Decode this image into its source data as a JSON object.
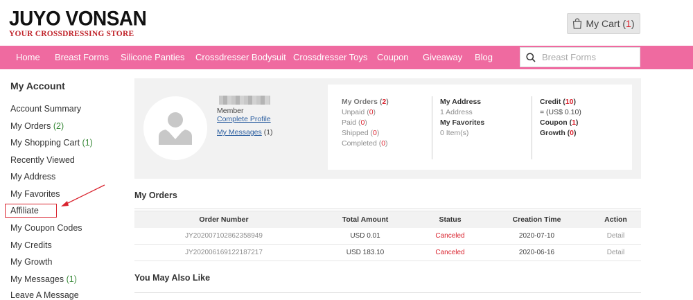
{
  "brand": {
    "name": "JUYO VONSAN",
    "tagline": "YOUR CROSSDRESSING STORE"
  },
  "cart": {
    "label": "My Cart",
    "count_open": "(",
    "count": "1",
    "count_close": ")"
  },
  "nav": [
    {
      "label": "Home"
    },
    {
      "label": "Breast Forms"
    },
    {
      "label": "Silicone Panties"
    },
    {
      "label": "Crossdresser Bodysuit"
    },
    {
      "label": "Crossdresser Toys"
    },
    {
      "label": "Coupon"
    },
    {
      "label": "Giveaway"
    },
    {
      "label": "Blog"
    }
  ],
  "search": {
    "placeholder": "Breast Forms"
  },
  "sidebar": {
    "title": "My Account",
    "items": [
      {
        "label": "Account Summary",
        "count": ""
      },
      {
        "label": "My Orders",
        "count": "(2)"
      },
      {
        "label": "My Shopping Cart",
        "count": "(1)"
      },
      {
        "label": "Recently Viewed",
        "count": ""
      },
      {
        "label": "My Address",
        "count": ""
      },
      {
        "label": "My Favorites",
        "count": ""
      },
      {
        "label": "Affiliate",
        "count": ""
      },
      {
        "label": "My Coupon Codes",
        "count": ""
      },
      {
        "label": "My Credits",
        "count": ""
      },
      {
        "label": "My Growth",
        "count": ""
      },
      {
        "label": "My Messages",
        "count": "(1)"
      },
      {
        "label": "Leave A Message",
        "count": ""
      }
    ]
  },
  "profile": {
    "level": "Member",
    "complete_profile": "Complete Profile",
    "messages_label": "My Messages",
    "messages_count": "(1)"
  },
  "stats": {
    "orders": {
      "title": "My Orders",
      "count": "2",
      "rows": [
        {
          "label": "Unpaid",
          "value": "0"
        },
        {
          "label": "Paid",
          "value": "0"
        },
        {
          "label": "Shipped",
          "value": "0"
        },
        {
          "label": "Completed",
          "value": "0"
        }
      ]
    },
    "address": {
      "title": "My Address",
      "detail": "1 Address"
    },
    "favorites": {
      "title": "My Favorites",
      "detail": "0 Item(s)"
    },
    "credit": {
      "label": "Credit",
      "value": "10",
      "usd": "= (US$ 0.10)"
    },
    "coupon": {
      "label": "Coupon",
      "value": "1"
    },
    "growth": {
      "label": "Growth",
      "value": "0"
    }
  },
  "orders_section": {
    "title": "My Orders",
    "columns": [
      "Order Number",
      "Total Amount",
      "Status",
      "Creation Time",
      "Action"
    ],
    "rows": [
      {
        "number": "JY202007102862358949",
        "amount": "USD 0.01",
        "status": "Canceled",
        "date": "2020-07-10",
        "action": "Detail"
      },
      {
        "number": "JY202006169122187217",
        "amount": "USD 183.10",
        "status": "Canceled",
        "date": "2020-06-16",
        "action": "Detail"
      }
    ]
  },
  "also_like": {
    "title": "You May Also Like"
  },
  "colors": {
    "nav_bg": "#ef6aa0",
    "accent_red": "#d9232e",
    "link_blue": "#2a5d9f"
  }
}
